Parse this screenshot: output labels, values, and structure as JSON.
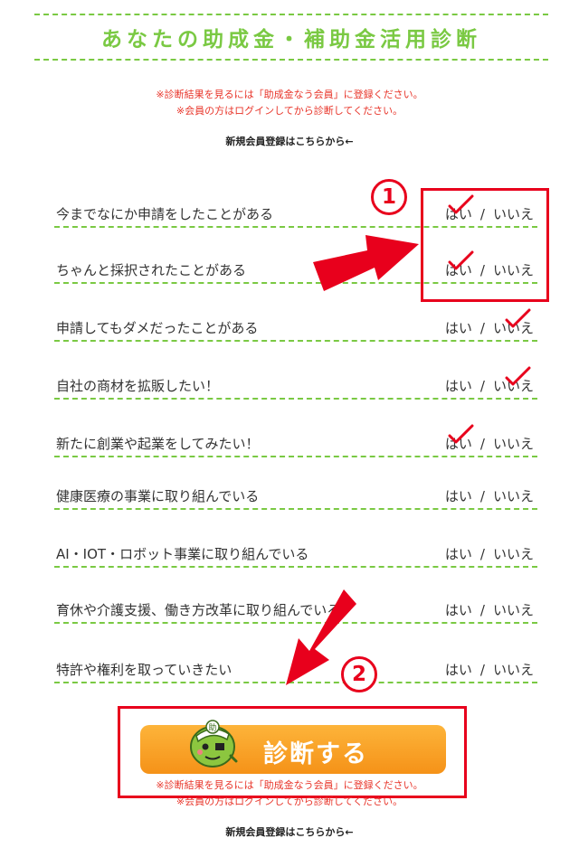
{
  "page": {
    "title": "あなたの助成金・補助金活用診断",
    "notice_line1": "※診断結果を見るには「助成金なう会員」に登録ください。",
    "notice_line2": "※会員の方はログインしてから診断してください。",
    "register_link": "新規会員登録はこちらから←"
  },
  "answer_labels": {
    "yes": "はい",
    "separator": "/",
    "no": "いいえ"
  },
  "questions": [
    {
      "text": "今までなにか申請をしたことがある",
      "checked": "yes"
    },
    {
      "text": "ちゃんと採択されたことがある",
      "checked": "yes"
    },
    {
      "text": "申請してもダメだったことがある",
      "checked": "no"
    },
    {
      "text": "自社の商材を拡販したい！",
      "checked": "no"
    },
    {
      "text": "新たに創業や起業をしてみたい！",
      "checked": "yes"
    },
    {
      "text": "健康医療の事業に取り組んでいる",
      "checked": ""
    },
    {
      "text": "AI・IOT・ロボット事業に取り組んでいる",
      "checked": ""
    },
    {
      "text": "育休や介護支援、働き方改革に取り組んでいる",
      "checked": ""
    },
    {
      "text": "特許や権利を取っていきたい",
      "checked": ""
    }
  ],
  "annotations": {
    "step1": "1",
    "step2": "2",
    "accent_color": "#e8001c"
  },
  "submit": {
    "label": "診断する",
    "notice_line1": "※診断結果を見るには「助成金なう会員」に登録ください。",
    "notice_line2": "※会員の方はログインしてから診断してください。",
    "register_link": "新規会員登録はこちらから←"
  },
  "mascot": {
    "badge": "助"
  },
  "colors": {
    "green": "#7ac943",
    "orange": "#f59218",
    "red": "#e8352a"
  }
}
